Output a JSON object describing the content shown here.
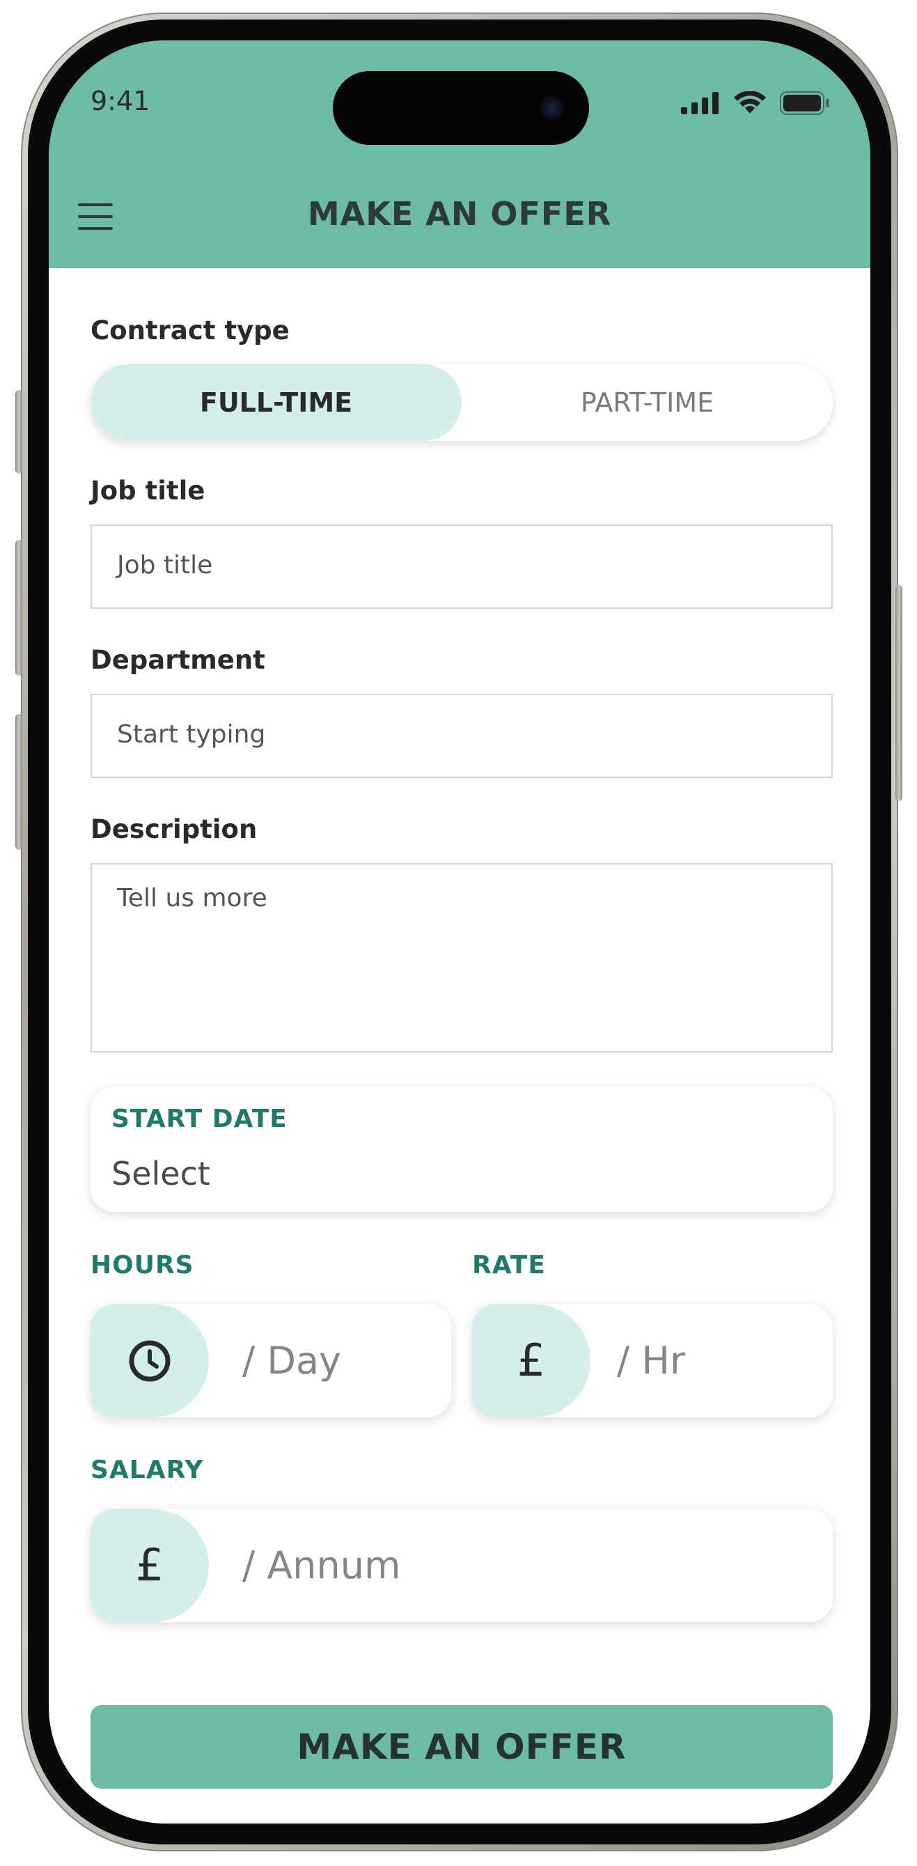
{
  "status_bar": {
    "time": "9:41",
    "icons": [
      "cellular-signal-icon",
      "wifi-icon",
      "battery-icon"
    ]
  },
  "header": {
    "title": "MAKE AN OFFER",
    "menu_icon": "hamburger-menu-icon"
  },
  "form": {
    "contract_type": {
      "label": "Contract type",
      "options": [
        "FULL-TIME",
        "PART-TIME"
      ],
      "selected": "FULL-TIME"
    },
    "job_title": {
      "label": "Job title",
      "placeholder": "Job title"
    },
    "department": {
      "label": "Department",
      "placeholder": "Start typing"
    },
    "description": {
      "label": "Description",
      "placeholder": "Tell us more"
    },
    "start_date": {
      "label": "START DATE",
      "value": "Select"
    },
    "hours": {
      "label": "HOURS",
      "placeholder": "/ Day",
      "icon": "clock-icon"
    },
    "rate": {
      "label": "RATE",
      "placeholder": "/ Hr",
      "symbol": "£"
    },
    "salary": {
      "label": "SALARY",
      "placeholder": "/ Annum",
      "symbol": "£"
    }
  },
  "submit": {
    "label": "MAKE AN OFFER"
  },
  "colors": {
    "primary": "#6dbaa7",
    "accent_light": "#d4efeb",
    "accent_text": "#1f7a6c"
  }
}
